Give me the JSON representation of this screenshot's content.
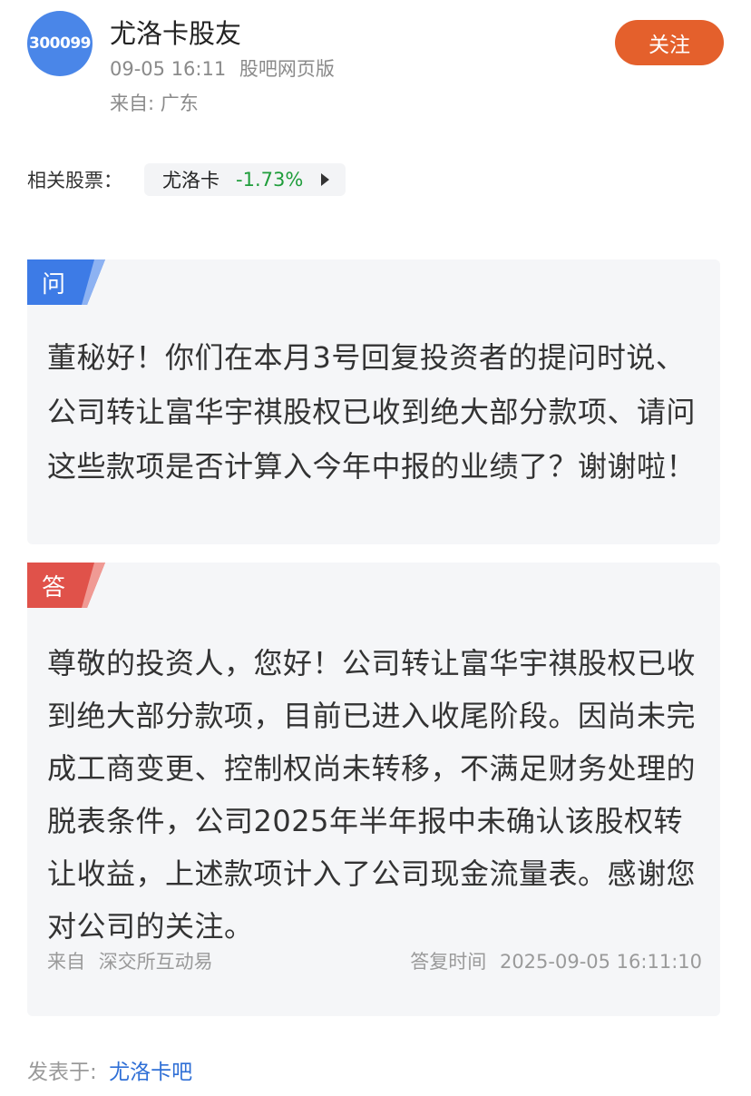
{
  "post": {
    "avatar_text": "300099",
    "username": "尤洛卡股友",
    "datetime": "09-05 16:11",
    "platform": "股吧网页版",
    "location": "来自: 广东",
    "follow_label": "关注"
  },
  "related": {
    "label": "相关股票：",
    "stock_name": "尤洛卡",
    "stock_change": "-1.73%"
  },
  "question": {
    "tag": "问",
    "text": "董秘好！你们在本月3号回复投资者的提问时说、公司转让富华宇祺股权已收到绝大部分款项、请问这些款项是否计算入今年中报的业绩了？谢谢啦！"
  },
  "answer": {
    "tag": "答",
    "text": "尊敬的投资人，您好！公司转让富华宇祺股权已收到绝大部分款项，目前已进入收尾阶段。因尚未完成工商变更、控制权尚未转移，不满足财务处理的脱表条件，公司2025年半年报中未确认该股权转让收益，上述款项计入了公司现金流量表。感谢您对公司的关注。",
    "source_label": "来自",
    "source_name": "深交所互动易",
    "reply_label": "答复时间",
    "reply_time": "2025-09-05 16:11:10"
  },
  "footer": {
    "posted_label": "发表于:",
    "posted_link": "尤洛卡吧"
  },
  "colors": {
    "follow": "#e4602c",
    "avatar": "#4a86e8",
    "question_tag": "#3d7be6",
    "answer_tag": "#e0524a",
    "change_negative": "#1f9d3b",
    "link": "#2f6fd6"
  }
}
